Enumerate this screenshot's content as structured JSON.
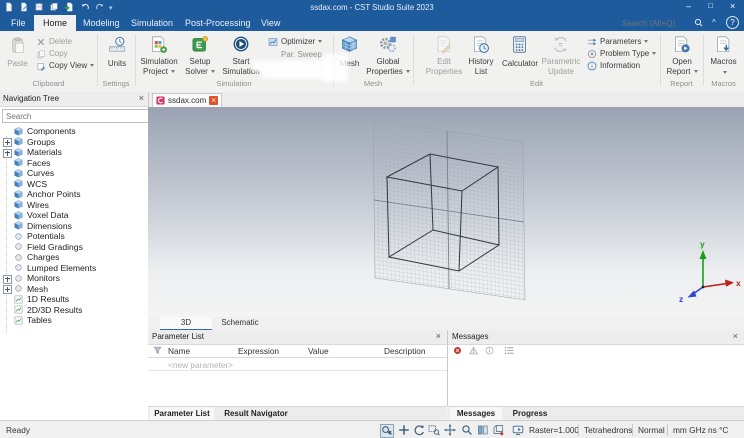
{
  "window": {
    "title": "ssdax.com - CST Studio Suite 2023",
    "minimize": "–",
    "maximize": "□",
    "close": "×"
  },
  "menu": {
    "tabs": [
      "File",
      "Home",
      "Modeling",
      "Simulation",
      "Post-Processing",
      "View"
    ],
    "active_tab": "Home",
    "search_placeholder": "Search (Alt+Q)",
    "collapse_glyph": "^",
    "help_glyph": "?"
  },
  "ribbon": {
    "clipboard": {
      "label": "Clipboard",
      "paste": "Paste",
      "delete": "Delete",
      "copy": "Copy",
      "copy_view": "Copy View"
    },
    "settings": {
      "label": "Settings",
      "units": "Units"
    },
    "simulation": {
      "label": "Simulation",
      "sim_project_1": "Simulation",
      "sim_project_2": "Project",
      "setup_solver_1": "Setup",
      "setup_solver_2": "Solver",
      "start_1": "Start",
      "start_2": "Simulation",
      "optimizer": "Optimizer",
      "par_sweep": "Par. Sweep"
    },
    "mesh": {
      "label": "Mesh",
      "mesh_btn": "Mesh",
      "global_1": "Global",
      "global_2": "Properties"
    },
    "edit": {
      "label": "Edit",
      "edit_props_1": "Edit",
      "edit_props_2": "Properties",
      "history_1": "History",
      "history_2": "List",
      "calculator": "Calculator",
      "parametric_1": "Parametric",
      "parametric_2": "Update",
      "parameters": "Parameters",
      "problem_type": "Problem Type",
      "information": "Information"
    },
    "report": {
      "label": "Report",
      "open_1": "Open",
      "open_2": "Report"
    },
    "macros": {
      "label": "Macros",
      "macros_btn": "Macros"
    }
  },
  "doc_tab": {
    "label": "ssdax.com",
    "close": "×"
  },
  "navigation": {
    "title": "Navigation Tree",
    "close": "×",
    "search_placeholder": "Search",
    "items": [
      {
        "label": "Components",
        "icon": "cube",
        "expandable": false
      },
      {
        "label": "Groups",
        "icon": "cube",
        "expandable": true
      },
      {
        "label": "Materials",
        "icon": "cube",
        "expandable": true
      },
      {
        "label": "Faces",
        "icon": "cube",
        "expandable": false
      },
      {
        "label": "Curves",
        "icon": "cube",
        "expandable": false
      },
      {
        "label": "WCS",
        "icon": "cube",
        "expandable": false
      },
      {
        "label": "Anchor Points",
        "icon": "cube",
        "expandable": false
      },
      {
        "label": "Wires",
        "icon": "cube",
        "expandable": false
      },
      {
        "label": "Voxel Data",
        "icon": "cube",
        "expandable": false
      },
      {
        "label": "Dimensions",
        "icon": "cube",
        "expandable": false
      },
      {
        "label": "Potentials",
        "icon": "circle",
        "expandable": false
      },
      {
        "label": "Field Gradings",
        "icon": "circle",
        "expandable": false
      },
      {
        "label": "Charges",
        "icon": "circle",
        "expandable": false
      },
      {
        "label": "Lumped Elements",
        "icon": "circle",
        "expandable": false
      },
      {
        "label": "Monitors",
        "icon": "circle",
        "expandable": true
      },
      {
        "label": "Mesh",
        "icon": "circle",
        "expandable": true
      },
      {
        "label": "1D Results",
        "icon": "chart",
        "expandable": false
      },
      {
        "label": "2D/3D Results",
        "icon": "chart",
        "expandable": false
      },
      {
        "label": "Tables",
        "icon": "chart",
        "expandable": false
      }
    ]
  },
  "viewport": {
    "tab_3d": "3D",
    "tab_schematic": "Schematic",
    "axis_x": "x",
    "axis_y": "y",
    "axis_z": "z"
  },
  "parameters_panel": {
    "title": "Parameter List",
    "close": "×",
    "col_name": "Name",
    "col_expression": "Expression",
    "col_value": "Value",
    "col_description": "Description",
    "new_row": "<new parameter>",
    "tab_parameter_list": "Parameter List",
    "tab_result_navigator": "Result Navigator"
  },
  "messages_panel": {
    "title": "Messages",
    "close": "×",
    "tab_messages": "Messages",
    "tab_progress": "Progress"
  },
  "statusbar": {
    "ready": "Ready",
    "raster": "Raster=1.000",
    "mesh_type": "Tetrahedrons",
    "mode": "Normal",
    "units": "mm GHz ns °C"
  }
}
